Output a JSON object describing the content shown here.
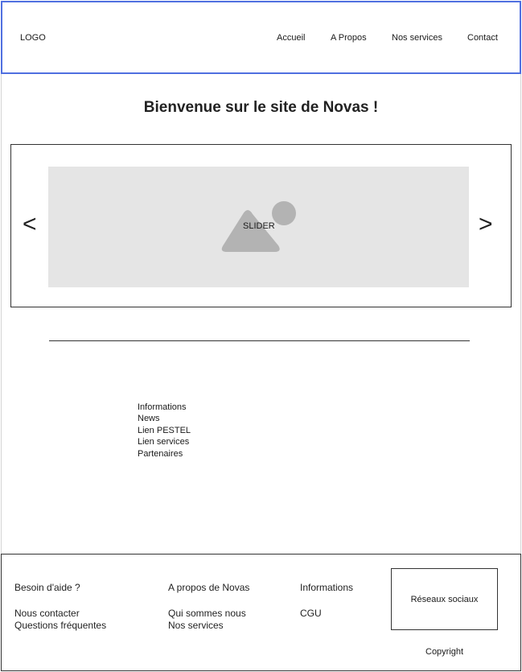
{
  "header": {
    "logo": "LOGO",
    "nav": [
      "Accueil",
      "A Propos",
      "Nos services",
      "Contact"
    ]
  },
  "welcome": "Bienvenue sur le site de Novas !",
  "slider": {
    "label": "SLIDER",
    "prev": "<",
    "next": ">",
    "image_icon": "image-placeholder-icon"
  },
  "info_links": [
    "Informations",
    "News",
    "Lien PESTEL",
    "Lien services",
    "Partenaires"
  ],
  "footer": {
    "help_title": "Besoin d'aide ?",
    "help_links": [
      "Nous contacter",
      "Questions fréquentes"
    ],
    "about_title": "A propos de Novas",
    "about_links": [
      "Qui sommes nous",
      "Nos services"
    ],
    "info_title": "Informations",
    "info_links": [
      "CGU"
    ],
    "social": "Réseaux sociaux",
    "copyright": "Copyright"
  },
  "colors": {
    "header_border": "#4f6fe0",
    "slider_bg": "#e5e5e5",
    "icon_gray": "#b3b3b3"
  }
}
